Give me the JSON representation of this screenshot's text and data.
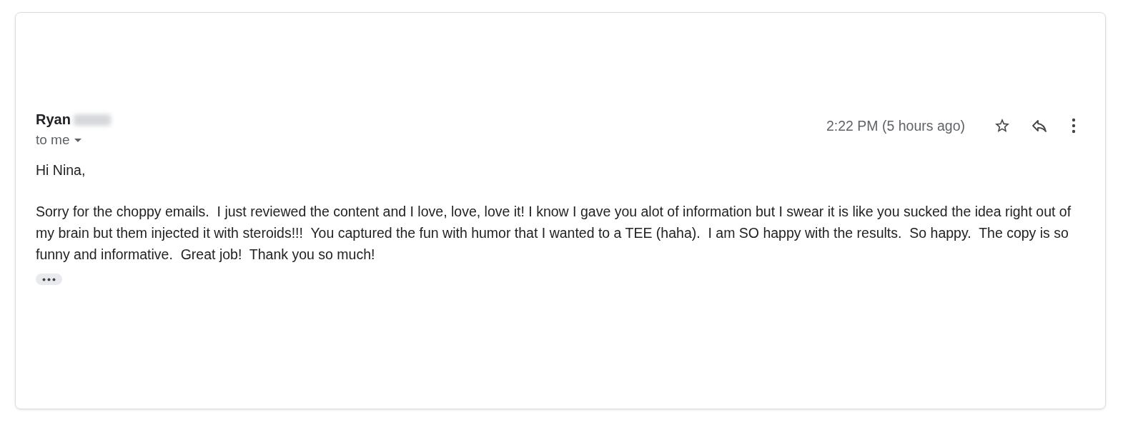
{
  "message": {
    "sender": "Ryan",
    "recipient_label": "to me",
    "time": "2:22 PM (5 hours ago)",
    "starred": false,
    "greeting": "Hi Nina,",
    "body": "Sorry for the choppy emails.  I just reviewed the content and I love, love, love it! I know I gave you alot of information but I swear it is like you sucked the idea right out of my brain but them injected it with steroids!!!  You captured the fun with humor that I wanted to a TEE (haha).  I am SO happy with the results.  So happy.  The copy is so funny and informative.  Great job!  Thank you so much!"
  }
}
